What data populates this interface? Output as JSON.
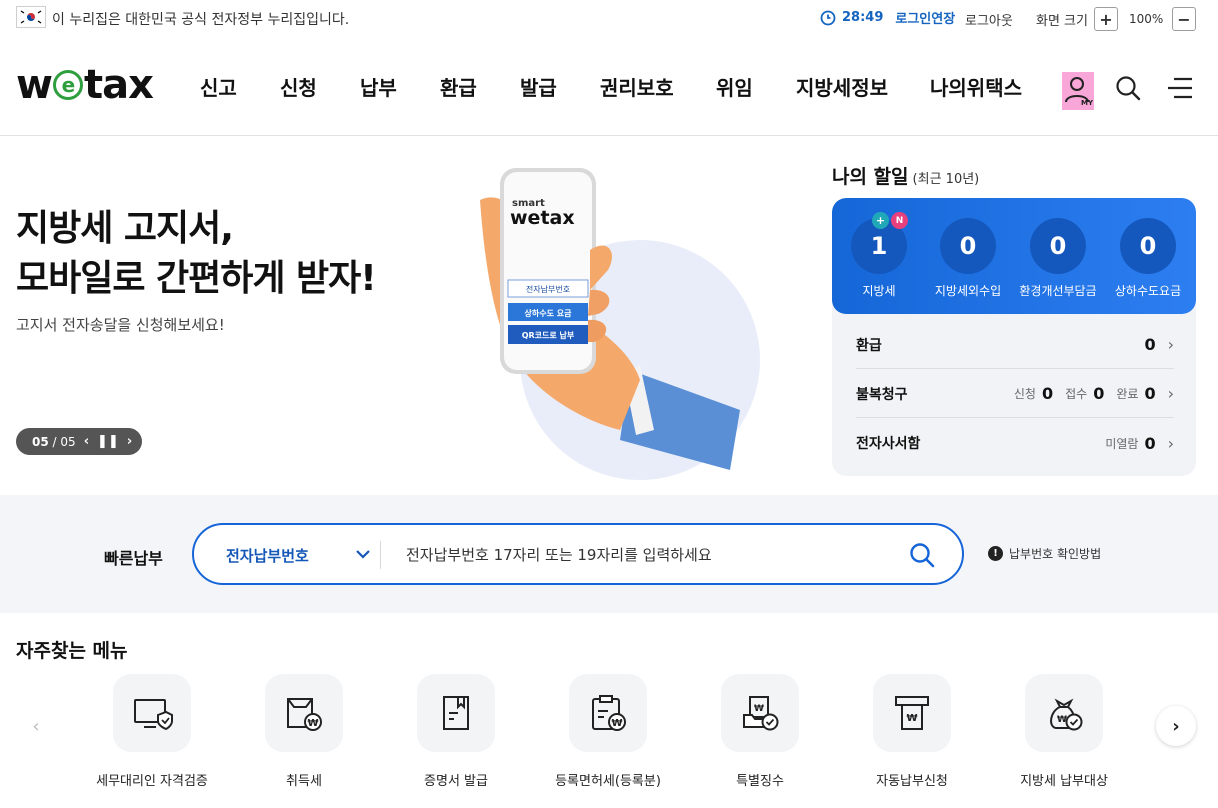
{
  "gov_banner": {
    "text": "이 누리집은 대한민국 공식 전자정부 누리집입니다.",
    "session_time": "28:49",
    "extend_login": "로그인연장",
    "logout": "로그아웃",
    "zoom_label": "화면 크기",
    "zoom_value": "100%",
    "zoom_in": "+",
    "zoom_out": "−"
  },
  "header": {
    "logo_pre": "w",
    "logo_e": "e",
    "logo_post": "tax",
    "my_label": "MY",
    "nav": [
      "신고",
      "신청",
      "납부",
      "환급",
      "발급",
      "권리보호",
      "위임",
      "지방세정보",
      "나의위택스"
    ]
  },
  "hero": {
    "title_line1": "지방세 고지서,",
    "title_line2": "모바일로 간편하게 받자!",
    "subtitle": "고지서 전자송달을 신청해보세요!",
    "slide_current": "05",
    "slide_sep": "/",
    "slide_total": "05",
    "phone_brand_small": "smart",
    "phone_brand": "wetax",
    "phone_buttons": [
      "전자납부번호",
      "상하수도 요금",
      "QR코드로 납부"
    ]
  },
  "my_tasks": {
    "title": "나의 할일",
    "period": "(최근 10년)",
    "stats": [
      {
        "label": "지방세",
        "value": "1"
      },
      {
        "label": "지방세외수입",
        "value": "0"
      },
      {
        "label": "환경개선부담금",
        "value": "0"
      },
      {
        "label": "상하수도요금",
        "value": "0"
      }
    ],
    "badge_plus": "+",
    "badge_new": "N",
    "refund": {
      "name": "환급",
      "value": "0"
    },
    "objection": {
      "name": "불복청구",
      "apply_label": "신청",
      "apply": "0",
      "receipt_label": "접수",
      "receipt": "0",
      "done_label": "완료",
      "done": "0"
    },
    "mailbox": {
      "name": "전자사서함",
      "unread_label": "미열람",
      "unread": "0"
    }
  },
  "quick_pay": {
    "label": "빠른납부",
    "select_value": "전자납부번호",
    "placeholder": "전자납부번호 17자리 또는 19자리를 입력하세요",
    "help_text": "납부번호 확인방법",
    "help_icon": "!"
  },
  "frequent_menu": {
    "title": "자주찾는 메뉴",
    "items": [
      {
        "label": "세무대리인 자격검증",
        "icon": "monitor-shield-icon"
      },
      {
        "label": "취득세",
        "icon": "box-won-icon"
      },
      {
        "label": "증명서 발급",
        "icon": "certificate-icon"
      },
      {
        "label": "등록면허세(등록분)",
        "icon": "clipboard-won-icon"
      },
      {
        "label": "특별징수",
        "icon": "tray-check-icon"
      },
      {
        "label": "자동납부신청",
        "icon": "auto-pay-icon"
      },
      {
        "label": "지방세 납부대상",
        "icon": "money-bag-icon"
      }
    ]
  },
  "colors": {
    "brand_blue": "#1565d8",
    "brand_green": "#2e9e3e",
    "badge_pink": "#e8407d",
    "badge_teal": "#20a8b8"
  }
}
